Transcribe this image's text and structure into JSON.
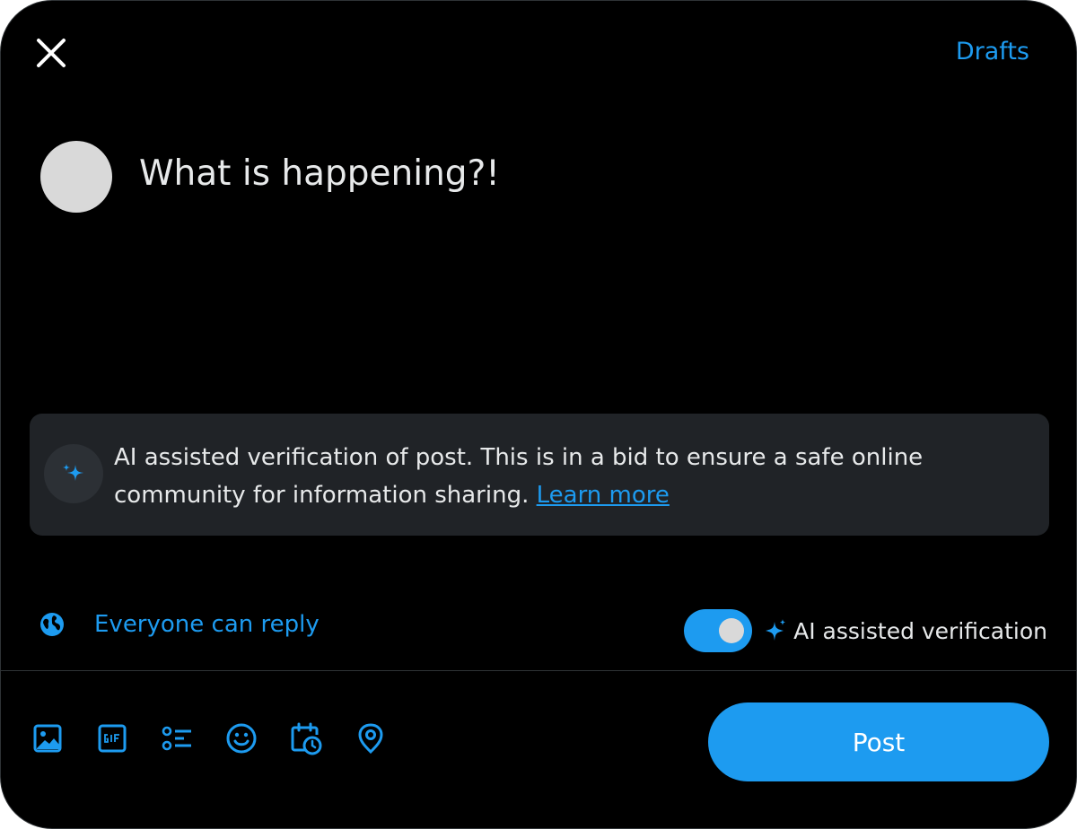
{
  "header": {
    "close_icon": "close-icon",
    "drafts_label": "Drafts"
  },
  "composer": {
    "placeholder": "What is happening?!"
  },
  "ai_notice": {
    "icon": "sparkle-icon",
    "text": "AI assisted verification of post. This is in a bid to ensure a safe online community for information sharing.",
    "learn_more_label": "Learn more"
  },
  "reply_setting": {
    "icon": "globe-icon",
    "label": "Everyone can reply"
  },
  "ai_toggle": {
    "enabled": true,
    "icon": "sparkle-icon",
    "label": "AI assisted verification"
  },
  "toolbar": {
    "tools": [
      {
        "name": "media-button",
        "icon": "image-icon"
      },
      {
        "name": "gif-button",
        "icon": "gif-icon"
      },
      {
        "name": "poll-button",
        "icon": "poll-icon"
      },
      {
        "name": "emoji-button",
        "icon": "emoji-icon"
      },
      {
        "name": "schedule-button",
        "icon": "schedule-icon"
      },
      {
        "name": "location-button",
        "icon": "location-icon"
      }
    ],
    "post_label": "Post"
  },
  "colors": {
    "accent": "#1d9bf0",
    "background": "#000000",
    "notice_background": "#202327",
    "text": "#e7e9ea",
    "avatar": "#d9d9d9"
  }
}
